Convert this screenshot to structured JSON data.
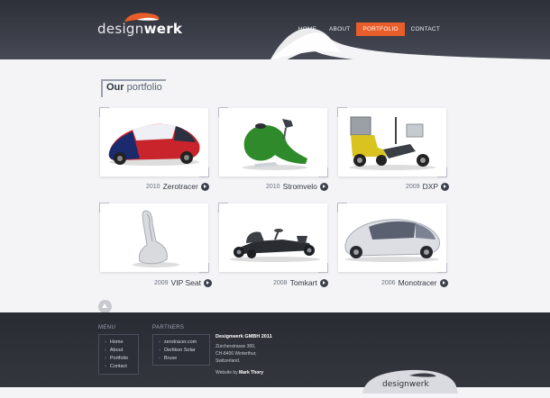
{
  "header": {
    "logo_light": "design",
    "logo_bold": "werk",
    "nav": [
      {
        "label": "HOME",
        "active": false
      },
      {
        "label": "ABOUT",
        "active": false
      },
      {
        "label": "PORTFOLIO",
        "active": true
      },
      {
        "label": "CONTACT",
        "active": false
      }
    ],
    "accent_color": "#e85e2a"
  },
  "portfolio": {
    "title_bold": "Our",
    "title_light": "portfolio",
    "items": [
      {
        "year": "2010",
        "name": "Zerotracer",
        "icon": "arrow-right-icon"
      },
      {
        "year": "2010",
        "name": "Stromvelo",
        "icon": "arrow-right-icon"
      },
      {
        "year": "2009",
        "name": "DXP",
        "icon": "arrow-right-icon"
      },
      {
        "year": "2009",
        "name": "VIP Seat",
        "icon": "arrow-right-icon"
      },
      {
        "year": "2008",
        "name": "Tomkart",
        "icon": "arrow-right-icon"
      },
      {
        "year": "2006",
        "name": "Monotracer",
        "icon": "arrow-right-icon"
      }
    ]
  },
  "footer": {
    "menu_heading": "MENU",
    "menu": [
      "Home",
      "About",
      "Portfolio",
      "Contact"
    ],
    "partners_heading": "PARTNERS",
    "partners": [
      "zerotracer.com",
      "Oerlikon Solar",
      "Bruse"
    ],
    "company": "Designwerk GMBH 2011",
    "address": [
      "Zürcherstrasse 300,",
      "CH-8406 Winterthur,",
      "Switzerland."
    ],
    "credit_prefix": "Website by",
    "credit_name": "Mark Thory",
    "logo_text": "designwerk"
  }
}
